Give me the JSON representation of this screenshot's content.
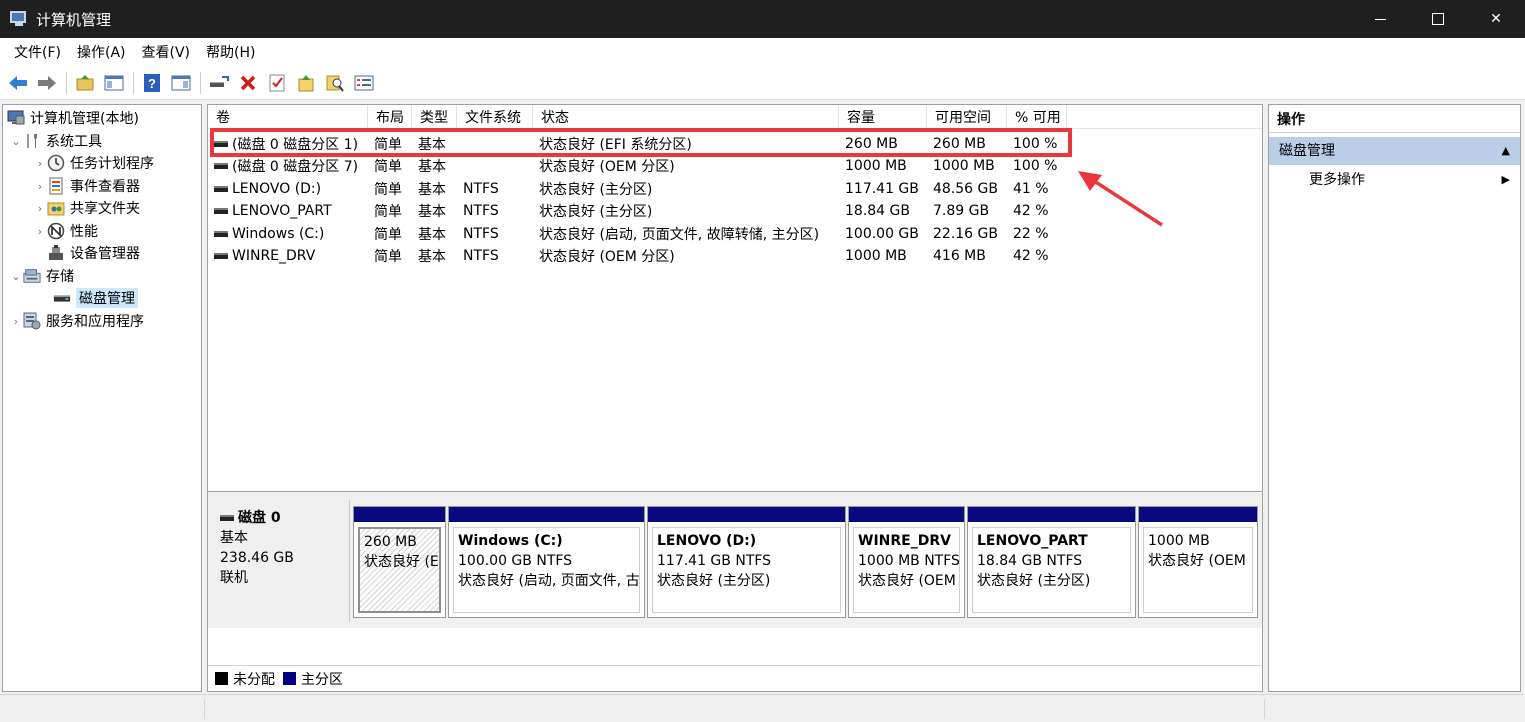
{
  "window": {
    "title": "计算机管理"
  },
  "menu": {
    "items": [
      "文件(F)",
      "操作(A)",
      "查看(V)",
      "帮助(H)"
    ]
  },
  "toolbar": {
    "icons": [
      "back-arrow-icon",
      "forward-arrow-icon",
      "up-folder-icon",
      "show-hide-tree-icon",
      "help-icon",
      "show-hide-action-pane-icon",
      "connect-icon",
      "delete-icon",
      "properties-icon",
      "open-icon",
      "search-icon",
      "list-icon"
    ]
  },
  "tree": {
    "root": "计算机管理(本地)",
    "system_tools": "系统工具",
    "task_scheduler": "任务计划程序",
    "event_viewer": "事件查看器",
    "shared_folders": "共享文件夹",
    "performance": "性能",
    "device_manager": "设备管理器",
    "storage": "存储",
    "disk_management": "磁盘管理",
    "services_apps": "服务和应用程序"
  },
  "volumes": {
    "headers": [
      "卷",
      "布局",
      "类型",
      "文件系统",
      "状态",
      "容量",
      "可用空间",
      "% 可用"
    ],
    "rows": [
      [
        "(磁盘 0 磁盘分区 1)",
        "简单",
        "基本",
        "",
        "状态良好 (EFI 系统分区)",
        "260 MB",
        "260 MB",
        "100 %"
      ],
      [
        "(磁盘 0 磁盘分区 7)",
        "简单",
        "基本",
        "",
        "状态良好 (OEM 分区)",
        "1000 MB",
        "1000 MB",
        "100 %"
      ],
      [
        "LENOVO (D:)",
        "简单",
        "基本",
        "NTFS",
        "状态良好 (主分区)",
        "117.41 GB",
        "48.56 GB",
        "41 %"
      ],
      [
        "LENOVO_PART",
        "简单",
        "基本",
        "NTFS",
        "状态良好 (主分区)",
        "18.84 GB",
        "7.89 GB",
        "42 %"
      ],
      [
        "Windows (C:)",
        "简单",
        "基本",
        "NTFS",
        "状态良好 (启动, 页面文件, 故障转储, 主分区)",
        "100.00 GB",
        "22.16 GB",
        "22 %"
      ],
      [
        "WINRE_DRV",
        "简单",
        "基本",
        "NTFS",
        "状态良好 (OEM 分区)",
        "1000 MB",
        "416 MB",
        "42 %"
      ]
    ]
  },
  "disk": {
    "name": "磁盘 0",
    "type": "基本",
    "size": "238.46 GB",
    "status": "联机",
    "partitions": [
      {
        "name": "",
        "size": "260 MB",
        "status": "状态良好 (E"
      },
      {
        "name": "Windows  (C:)",
        "size": "100.00 GB NTFS",
        "status": "状态良好 (启动, 页面文件, 古"
      },
      {
        "name": "LENOVO  (D:)",
        "size": "117.41 GB NTFS",
        "status": "状态良好 (主分区)"
      },
      {
        "name": "WINRE_DRV",
        "size": "1000 MB NTFS",
        "status": "状态良好 (OEM"
      },
      {
        "name": "LENOVO_PART",
        "size": "18.84 GB NTFS",
        "status": "状态良好 (主分区)"
      },
      {
        "name": "",
        "size": "1000 MB",
        "status": "状态良好 (OEM"
      }
    ]
  },
  "legend": {
    "unallocated": "未分配",
    "primary": "主分区",
    "unallocated_color": "#000000",
    "primary_color": "#000080"
  },
  "actions": {
    "title": "操作",
    "section": "磁盘管理",
    "more": "更多操作"
  },
  "colors": {
    "highlight": "#e8383d",
    "partition_bar": "#0a0a80",
    "selected": "#cce8ff",
    "section_bg": "#b9cfe8"
  }
}
